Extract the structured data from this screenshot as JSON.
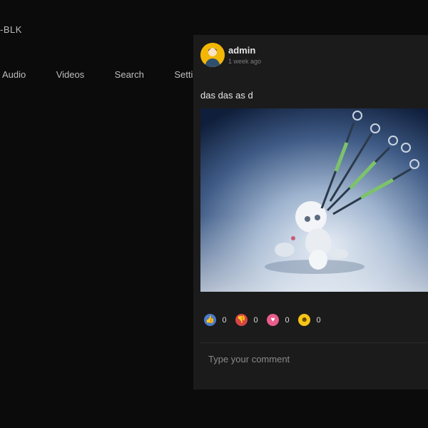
{
  "site": {
    "brand": "-BLK"
  },
  "nav": {
    "items": [
      {
        "label": "Audio"
      },
      {
        "label": "Videos"
      },
      {
        "label": "Search"
      },
      {
        "label": "Settings"
      }
    ]
  },
  "post": {
    "author": "admin",
    "time": "1 week ago",
    "text": "das das as d",
    "image_icon": "syringe-figure-illustration",
    "reactions": [
      {
        "name": "like",
        "icon": "thumbs-up-icon",
        "color": "#4b7cc9",
        "count": "0"
      },
      {
        "name": "dislike",
        "icon": "thumbs-down-icon",
        "color": "#d64545",
        "count": "0"
      },
      {
        "name": "love",
        "icon": "heart-icon",
        "color": "#e85d8a",
        "count": "0"
      },
      {
        "name": "haha",
        "icon": "laughing-face-icon",
        "color": "#f5c518",
        "count": "0"
      }
    ]
  },
  "comment": {
    "placeholder": "Type your comment"
  },
  "colors": {
    "background": "#0b0b0b",
    "panel": "#1b1b1b",
    "text": "#e6e6e6",
    "avatar": "#f2b705"
  }
}
